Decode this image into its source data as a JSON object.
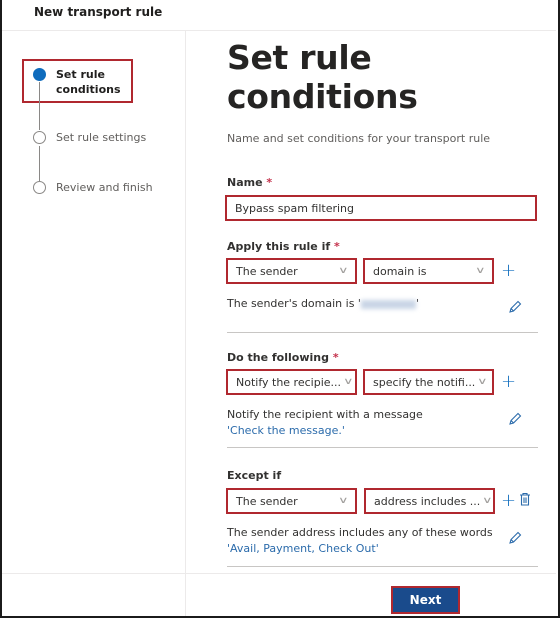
{
  "header": {
    "title": "New transport rule"
  },
  "steps": [
    {
      "label_line1": "Set rule",
      "label_line2": "conditions",
      "state": "current"
    },
    {
      "label": "Set rule settings",
      "state": "pending"
    },
    {
      "label": "Review and finish",
      "state": "pending"
    }
  ],
  "main": {
    "title": "Set rule conditions",
    "description": "Name and set conditions for your transport rule",
    "name_field": {
      "label": "Name",
      "required_mark": "*",
      "value": "Bypass spam filtering"
    },
    "apply_if": {
      "label": "Apply this rule if",
      "required_mark": "*",
      "condition": "The sender",
      "operator": "domain is",
      "summary_prefix": "The sender's domain is '",
      "summary_suffix": "'"
    },
    "do_following": {
      "label": "Do the following",
      "required_mark": "*",
      "action": "Notify the recipie...",
      "operator": "specify the notifi...",
      "summary": "Notify the recipient with a message",
      "value": "'Check the message.'"
    },
    "except_if": {
      "label": "Except if",
      "condition": "The sender",
      "operator": "address includes ...",
      "summary": "The sender address includes any of these words",
      "value": "'Avail, Payment, Check Out'"
    }
  },
  "footer": {
    "next_label": "Next"
  },
  "icons": {
    "add": "+",
    "chevron": "∨"
  },
  "colors": {
    "accent": "#0f6cbd",
    "primary_button": "#1a4b8c",
    "highlight_border": "#b0282f",
    "link": "#2b6bab"
  }
}
